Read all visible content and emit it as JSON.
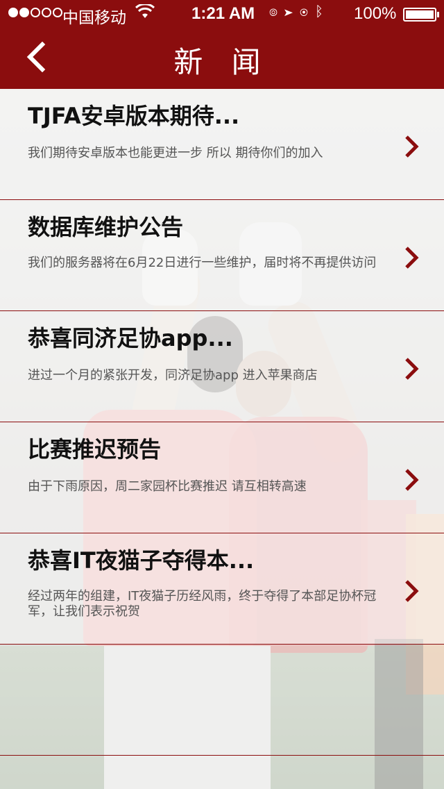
{
  "statusbar": {
    "carrier": "中国移动",
    "time": "1:21 AM",
    "battery_text": "100%",
    "signal_bars_filled": 2,
    "signal_bars_total": 5
  },
  "navbar": {
    "title": "新 闻"
  },
  "news": [
    {
      "title": "TJFA安卓版本期待...",
      "summary": "我们期待安卓版本也能更进一步 所以 期待你们的加入"
    },
    {
      "title": "数据库维护公告",
      "summary": "我们的服务器将在6月22日进行一些维护，届时将不再提供访问"
    },
    {
      "title": "恭喜同济足协app...",
      "summary": "进过一个月的紧张开发，同济足协app 进入苹果商店"
    },
    {
      "title": "比赛推迟预告",
      "summary": "由于下雨原因，周二家园杯比赛推迟 请互相转高速"
    },
    {
      "title": "恭喜IT夜猫子夺得本...",
      "summary": "经过两年的组建，IT夜猫子历经风雨，终于夺得了本部足协杯冠军，让我们表示祝贺"
    }
  ],
  "colors": {
    "brand": "#8b0d0e",
    "title_text": "#111111",
    "summary_text": "#555555"
  },
  "icons": {
    "back": "chevron-left-icon",
    "row_disclosure": "chevron-right-icon"
  }
}
